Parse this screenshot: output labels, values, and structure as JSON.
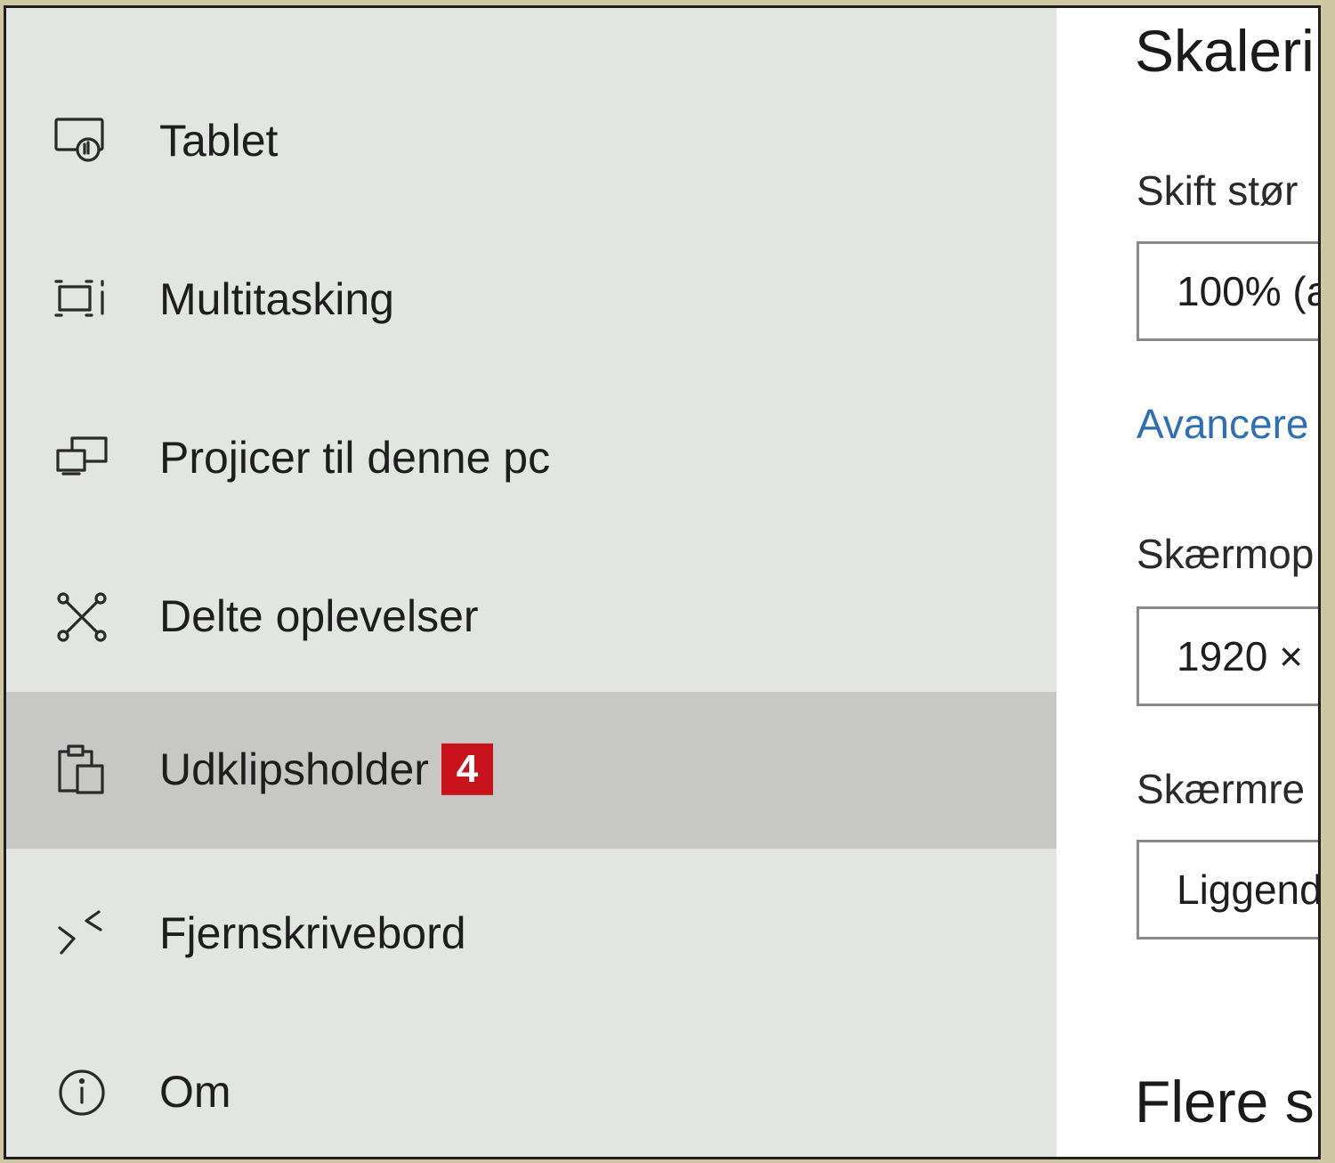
{
  "sidebar": {
    "items": [
      {
        "label": "Tablet",
        "icon": "tablet-icon"
      },
      {
        "label": "Multitasking",
        "icon": "multitasking-icon"
      },
      {
        "label": "Projicer til denne pc",
        "icon": "project-icon"
      },
      {
        "label": "Delte oplevelser",
        "icon": "shared-experiences-icon"
      },
      {
        "label": "Udklipsholder",
        "icon": "clipboard-icon",
        "selected": true,
        "badge": "4"
      },
      {
        "label": "Fjernskrivebord",
        "icon": "remote-desktop-icon"
      },
      {
        "label": "Om",
        "icon": "info-icon"
      }
    ]
  },
  "content": {
    "heading": "Skaleri",
    "scale_label": "Skift stør",
    "scale_value": "100% (a",
    "advanced_link": "Avancere",
    "resolution_label": "Skærmop",
    "resolution_value": "1920 ×",
    "orientation_label": "Skærmre",
    "orientation_value": "Liggend",
    "multiple_heading": "Flere sk"
  },
  "colors": {
    "sidebar_bg": "#e3e5e2",
    "selected_bg": "#c7c8c6",
    "badge_bg": "#c8121c",
    "link": "#2f6fb5"
  }
}
